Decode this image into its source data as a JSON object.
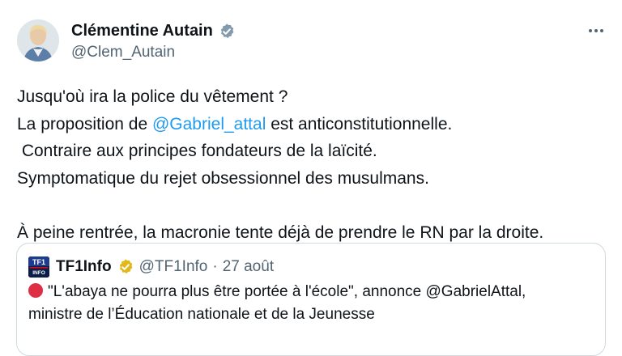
{
  "author": {
    "name": "Clémentine Autain",
    "handle": "@Clem_Autain",
    "verified": true,
    "verified_color": "#829aab"
  },
  "tweet": {
    "line1": "Jusqu'où ira la police du vêtement ?",
    "line2_prefix": "La proposition de ",
    "line2_mention": "@Gabriel_attal",
    "line2_suffix": " est anticonstitutionnelle.",
    "line3": " Contraire aux principes fondateurs de la laïcité.",
    "line4": "Symptomatique du rejet obsessionnel des musulmans.",
    "line5": "À peine rentrée, la macronie tente déjà de prendre le RN par la droite."
  },
  "quote": {
    "name": "TF1Info",
    "handle": "@TF1Info",
    "separator": "·",
    "date": "27 août",
    "badge_color": "#e2b719",
    "logo_text_top": "TF1",
    "logo_text_bottom": "INFO",
    "body_line1": "\"L'abaya ne pourra plus être portée à l'école\", annonce @GabrielAttal,",
    "body_line2": "ministre de l’Éducation nationale et de la Jeunesse"
  },
  "icons": {
    "more": "more-horizontal-icon",
    "verified": "verified-badge-icon",
    "red_circle": "red-circle-emoji"
  },
  "colors": {
    "link": "#1d9bf0",
    "text": "#0f1419",
    "secondary": "#536471",
    "border": "#cfd9de"
  }
}
